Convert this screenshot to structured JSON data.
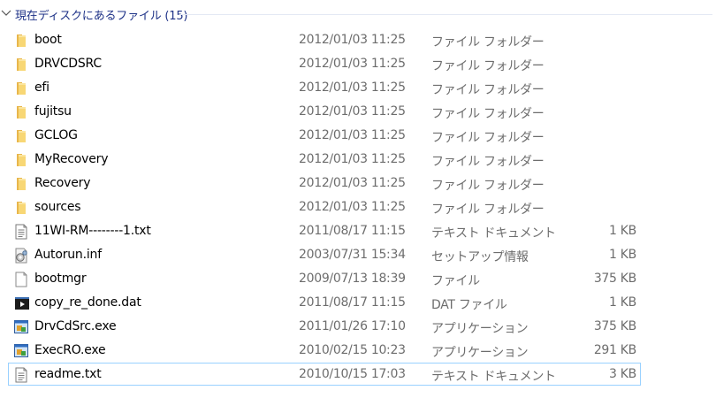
{
  "group": {
    "title": "現在ディスクにあるファイル (15)",
    "expanded": true
  },
  "files": [
    {
      "name": "boot",
      "date": "2012/01/03 11:25",
      "type": "ファイル フォルダー",
      "size": "",
      "icon": "folder-icon"
    },
    {
      "name": "DRVCDSRC",
      "date": "2012/01/03 11:25",
      "type": "ファイル フォルダー",
      "size": "",
      "icon": "folder-icon"
    },
    {
      "name": "efi",
      "date": "2012/01/03 11:25",
      "type": "ファイル フォルダー",
      "size": "",
      "icon": "folder-icon"
    },
    {
      "name": "fujitsu",
      "date": "2012/01/03 11:25",
      "type": "ファイル フォルダー",
      "size": "",
      "icon": "folder-icon"
    },
    {
      "name": "GCLOG",
      "date": "2012/01/03 11:25",
      "type": "ファイル フォルダー",
      "size": "",
      "icon": "folder-icon"
    },
    {
      "name": "MyRecovery",
      "date": "2012/01/03 11:25",
      "type": "ファイル フォルダー",
      "size": "",
      "icon": "folder-icon"
    },
    {
      "name": "Recovery",
      "date": "2012/01/03 11:25",
      "type": "ファイル フォルダー",
      "size": "",
      "icon": "folder-icon"
    },
    {
      "name": "sources",
      "date": "2012/01/03 11:25",
      "type": "ファイル フォルダー",
      "size": "",
      "icon": "folder-icon"
    },
    {
      "name": "11WI-RM--------1.txt",
      "date": "2011/08/17 11:15",
      "type": "テキスト ドキュメント",
      "size": "1 KB",
      "icon": "text-document-icon"
    },
    {
      "name": "Autorun.inf",
      "date": "2003/07/31 15:34",
      "type": "セットアップ情報",
      "size": "1 KB",
      "icon": "setup-info-icon"
    },
    {
      "name": "bootmgr",
      "date": "2009/07/13 18:39",
      "type": "ファイル",
      "size": "375 KB",
      "icon": "blank-file-icon"
    },
    {
      "name": "copy_re_done.dat",
      "date": "2011/08/17 11:15",
      "type": "DAT ファイル",
      "size": "1 KB",
      "icon": "media-file-icon"
    },
    {
      "name": "DrvCdSrc.exe",
      "date": "2011/01/26 17:10",
      "type": "アプリケーション",
      "size": "375 KB",
      "icon": "application-icon"
    },
    {
      "name": "ExecRO.exe",
      "date": "2010/02/15 10:23",
      "type": "アプリケーション",
      "size": "291 KB",
      "icon": "application-icon"
    },
    {
      "name": "readme.txt",
      "date": "2010/10/15 17:03",
      "type": "テキスト ドキュメント",
      "size": "3 KB",
      "icon": "text-document-icon",
      "selected": true
    }
  ],
  "colors": {
    "header_text": "#1e3287",
    "detail_text": "#6d6d6d",
    "selection_border": "#99d1ff",
    "folder": "#f8d775"
  }
}
